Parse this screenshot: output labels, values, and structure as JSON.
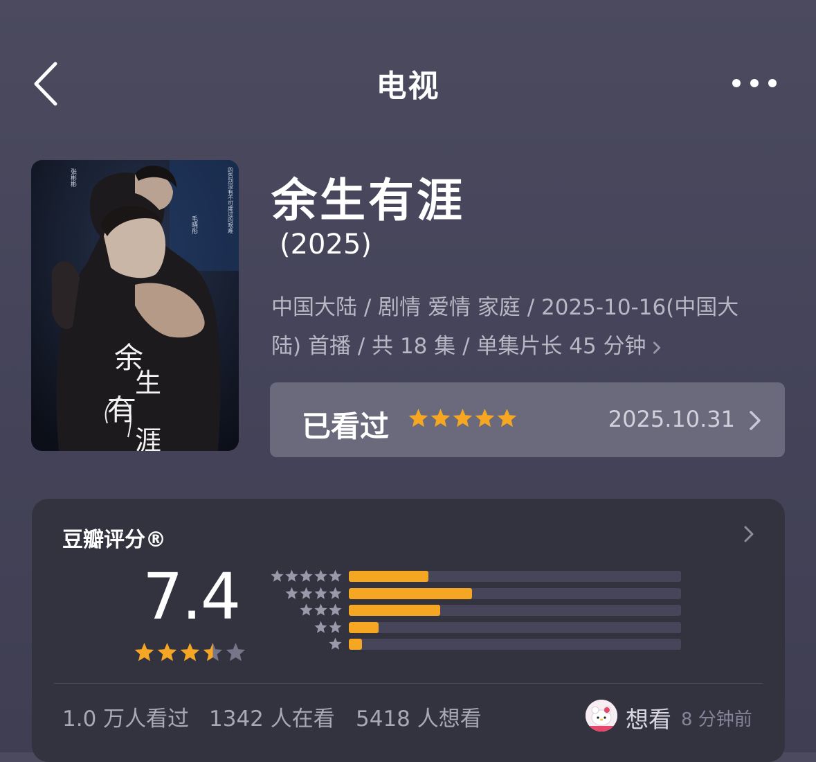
{
  "header": {
    "title": "电视"
  },
  "show": {
    "name": "余生有涯",
    "year": "(2025)",
    "meta_line1": "中国大陆 / 剧情 爱情 家庭 / 2025-10-16(中国大",
    "meta_line2": "陆) 首播 / 共 18 集 / 单集片长 45 分钟"
  },
  "poster": {
    "calligraphy": [
      "余",
      "生",
      "有",
      "涯"
    ]
  },
  "watched": {
    "label": "已看过",
    "stars": 5,
    "date": "2025.10.31"
  },
  "douban": {
    "title": "豆瓣评分®",
    "score": "7.4",
    "score_stars": 3.5,
    "distribution": [
      {
        "stars": 5,
        "fraction": 0.24
      },
      {
        "stars": 4,
        "fraction": 0.37
      },
      {
        "stars": 3,
        "fraction": 0.275
      },
      {
        "stars": 2,
        "fraction": 0.09
      },
      {
        "stars": 1,
        "fraction": 0.04
      }
    ],
    "stats": {
      "watched": "1.0 万人看过",
      "watching": "1342 人在看",
      "want": "5418 人想看"
    },
    "friend_action": "想看",
    "friend_time": "8 分钟前"
  },
  "colors": {
    "accent_star": "#f5a623",
    "empty_star": "#76758a",
    "gray_star": "#9a99ab"
  },
  "icons": [
    "back-chevron-icon",
    "more-dots-icon",
    "chevron-right-icon",
    "star-icon",
    "avatar-hello-kitty-icon"
  ]
}
